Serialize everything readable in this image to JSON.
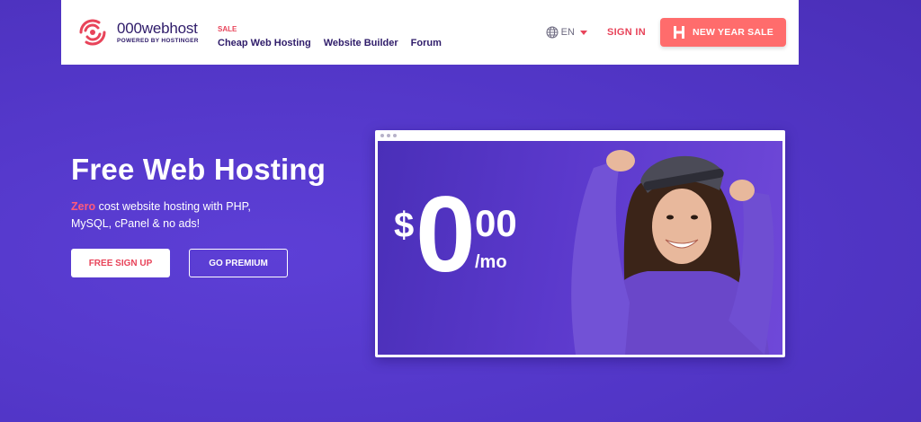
{
  "brand": {
    "name": "000webhost",
    "tagline": "POWERED BY HOSTINGER",
    "logo_icon": "swirl-logo-icon"
  },
  "nav": {
    "items": [
      {
        "label": "Cheap Web Hosting",
        "tag": "SALE"
      },
      {
        "label": "Website Builder",
        "tag": ""
      },
      {
        "label": "Forum",
        "tag": ""
      }
    ]
  },
  "header": {
    "language": "EN",
    "language_icon": "globe-icon",
    "signin_label": "SIGN IN",
    "sale_button_label": "NEW YEAR SALE",
    "sale_button_icon": "hostinger-h-icon"
  },
  "hero": {
    "title": "Free Web Hosting",
    "description_highlight": "Zero",
    "description_rest": " cost website hosting with PHP, MySQL, cPanel & no ads!",
    "signup_label": "FREE SIGN UP",
    "premium_label": "GO PREMIUM"
  },
  "promo": {
    "currency": "$",
    "whole": "0",
    "cents": "00",
    "period": "/mo"
  },
  "colors": {
    "background": "#5236c7",
    "accent_red": "#e8445a",
    "sale_button": "#ff6c6c",
    "brand_navy": "#2f1c6a"
  }
}
